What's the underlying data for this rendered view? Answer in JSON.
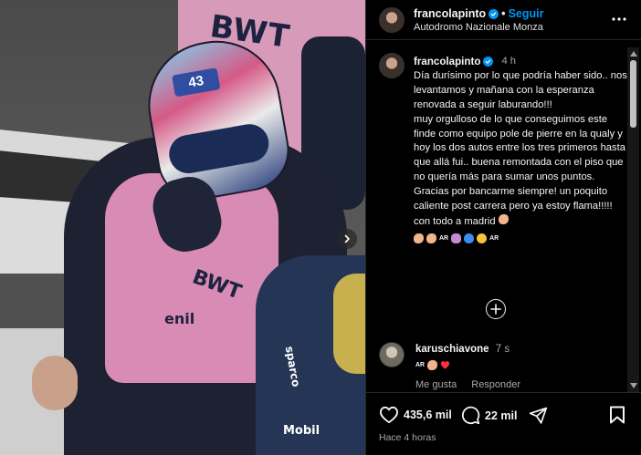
{
  "photo": {
    "helmet_number": "43",
    "crew_sponsor": "BWT",
    "suit_sponsors": [
      "enil",
      "BWT",
      "sparco",
      "Mobil"
    ]
  },
  "header": {
    "username": "francolapinto",
    "separator": "•",
    "follow_label": "Seguir",
    "location": "Autodromo Nazionale Monza"
  },
  "caption": {
    "username": "francolapinto",
    "time": "4 h",
    "text": "Día durísimo por lo que podría haber sido.. nos levantamos y mañana con la esperanza renovada a seguir laburando!!!\nmuy orgulloso de lo que conseguimos este finde como equipo pole de pierre en la qualy y hoy los dos autos entre los tres primeros hasta que allá fui.. buena remontada con el piso que no quería más para sumar unos puntos. Gracias por bancarme siempre! un poquito caliente post carrera pero ya estoy flama!!!!! con todo a madrid",
    "flag_1": "AR",
    "flag_2": "AR"
  },
  "comment": {
    "username": "karuschiavone",
    "time": "7 s",
    "flag": "AR",
    "like_label": "Me gusta",
    "reply_label": "Responder"
  },
  "actions": {
    "likes": "435,6 mil",
    "comments": "22 mil",
    "time_ago": "Hace 4 horas"
  },
  "colors": {
    "accent": "#0095f6",
    "background": "#000000",
    "text": "#f5f5f5",
    "muted": "#a8a8a8",
    "heart_red": "#ff3040"
  }
}
